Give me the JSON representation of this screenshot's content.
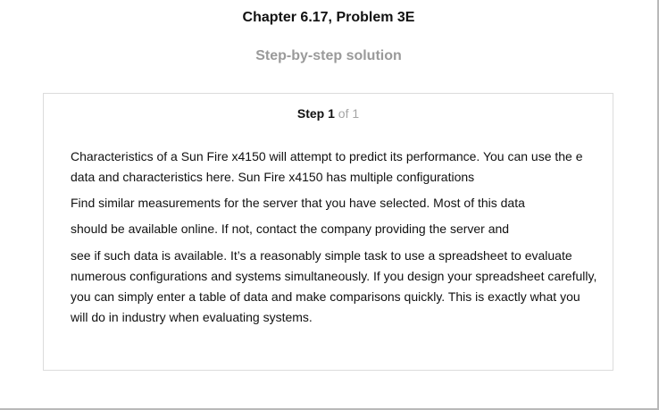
{
  "header": {
    "chapter_title": "Chapter 6.17, Problem 3E",
    "subtitle": "Step-by-step solution"
  },
  "step": {
    "word": "Step",
    "number": "1",
    "of_text": "of 1",
    "paragraphs": [
      "Characteristics of a Sun Fire x4150 will attempt to predict its performance. You can use the e data and characteristics here. Sun Fire x4150 has multiple configurations",
      "Find similar measurements for the server that you have selected. Most of this data",
      "should be available online. If not, contact the company providing the server and",
      "see if such data is available. It’s a reasonably simple task to use a spreadsheet to evaluate numerous configurations and systems simultaneously. If you design your spreadsheet carefully, you can simply enter a table of data and make comparisons quickly. This is exactly what you will do in industry when evaluating systems."
    ]
  }
}
